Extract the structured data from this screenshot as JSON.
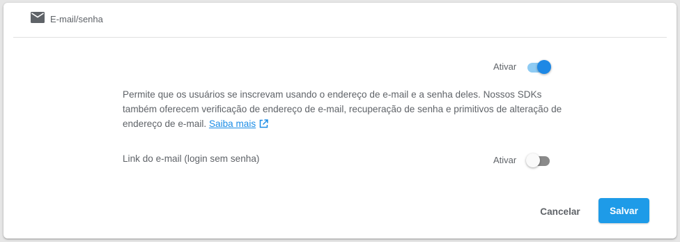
{
  "header": {
    "icon": "mail-icon",
    "title": "E-mail/senha"
  },
  "email_password": {
    "toggle_label": "Ativar",
    "enabled": true,
    "description": "Permite que os usuários se inscrevam usando o endereço de e-mail e a senha deles. Nossos SDKs também oferecem verificação de endereço de e-mail, recuperação de senha e primitivos de alteração de endereço de e-mail.",
    "learn_more_label": "Saiba mais",
    "learn_more_icon": "external-link-icon"
  },
  "email_link": {
    "label": "Link do e-mail (login sem senha)",
    "toggle_label": "Ativar",
    "enabled": false
  },
  "actions": {
    "cancel_label": "Cancelar",
    "save_label": "Salvar"
  },
  "colors": {
    "accent": "#1e88e5",
    "save_button": "#1e9be8",
    "link": "#1a8ce6",
    "text_secondary": "#5f6368"
  }
}
